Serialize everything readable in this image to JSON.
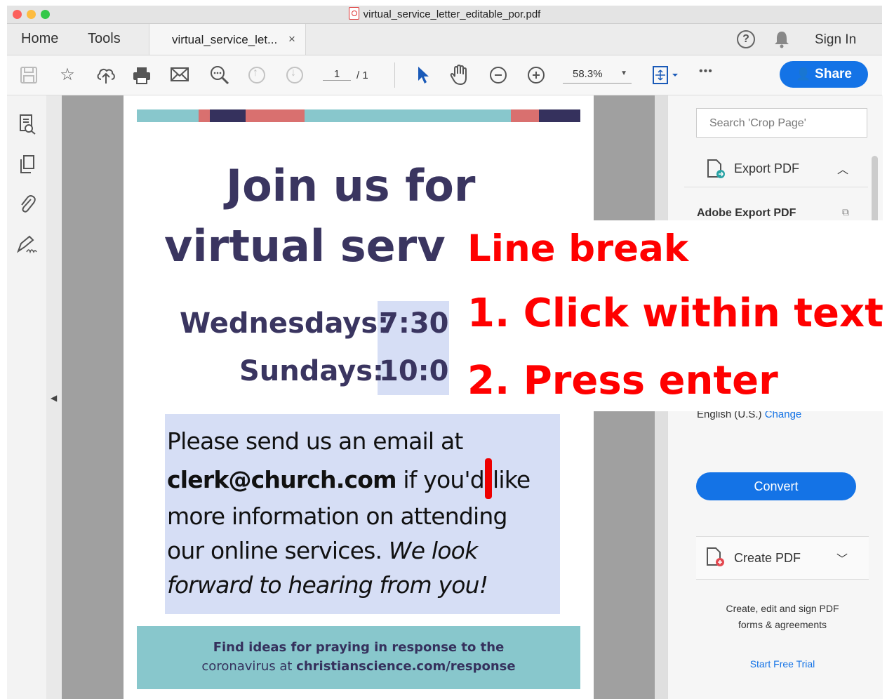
{
  "window": {
    "title": "virtual_service_letter_editable_por.pdf"
  },
  "tabs": {
    "home": "Home",
    "tools": "Tools",
    "doc_tab": "virtual_service_let...",
    "close": "×"
  },
  "header_right": {
    "help": "?",
    "sign_in": "Sign In"
  },
  "toolbar": {
    "page_current": "1",
    "page_total": "/ 1",
    "zoom": "58.3%",
    "more": "•••",
    "share": "Share"
  },
  "document": {
    "title_line1": "Join us for",
    "title_line2": "virtual serv",
    "wed_label": "Wednesdays:",
    "wed_time": "7:30",
    "sun_label": "Sundays:",
    "sun_time": "10:0(",
    "para_1": "Please send us an email at",
    "para_email": "clerk@church.com",
    "para_2a": " if you'd",
    "para_2b": "like",
    "para_3": "more information on attending",
    "para_4": "our online services. ",
    "para_4_italic": "We look",
    "para_5_italic": "forward to hearing from you!",
    "footer_1": "Find ideas for praying in response to the",
    "footer_2_prefix": "coronavirus at ",
    "footer_2_link": "christianscience.com/response",
    "stripe_colors": [
      "#88c7cc",
      "#d9706f",
      "#35315d"
    ]
  },
  "right_panel": {
    "search_placeholder": "Search 'Crop Page'",
    "export_title": "Export PDF",
    "adobe_export": "Adobe Export PDF",
    "language": "English (U.S.)",
    "change": "Change",
    "convert": "Convert",
    "create_title": "Create PDF",
    "create_desc_1": "Create, edit and sign PDF",
    "create_desc_2": "forms & agreements",
    "trial": "Start Free Trial"
  },
  "annotation": {
    "heading": "Line break",
    "step1": "1. Click within text",
    "step2": "2. Press enter"
  }
}
